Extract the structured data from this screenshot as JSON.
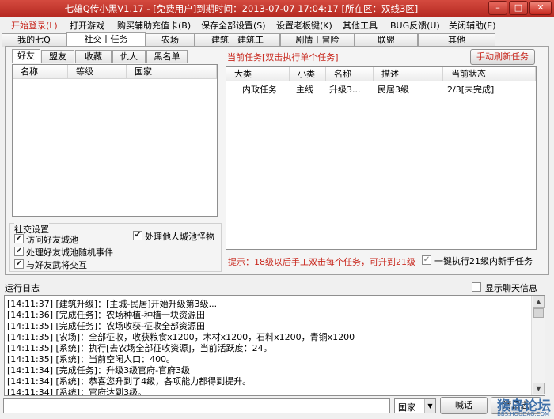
{
  "window": {
    "title": "七雄Q传小黑V1.17 - [免费用户]到期时间：2013-07-07 17:04:17 [所在区：双线3区]",
    "buttons": {
      "minimize": "–",
      "maximize": "□",
      "close": "✕"
    }
  },
  "menu": [
    "开始登录(L)",
    "打开游戏",
    "购买辅助充值卡(B)",
    "保存全部设置(S)",
    "设置老板键(K)",
    "其他工具",
    "BUG反馈(U)",
    "关闭辅助(E)"
  ],
  "tabs": [
    "我的七Q",
    "社交丨任务",
    "农场",
    "建筑丨建筑工",
    "剧情丨冒险",
    "联盟",
    "其他"
  ],
  "friends": {
    "subtabs": [
      "好友",
      "盟友",
      "收藏",
      "仇人",
      "黑名单"
    ],
    "columns": [
      "名称",
      "等级",
      "国家"
    ]
  },
  "social": {
    "title": "社交设置",
    "options": [
      {
        "label": "访问好友城池",
        "checked": true
      },
      {
        "label": "处理好友城池随机事件",
        "checked": true
      },
      {
        "label": "与好友武将交互",
        "checked": true
      },
      {
        "label": "处理他人城池怪物",
        "checked": true
      }
    ]
  },
  "tasks": {
    "title": "当前任务[双击执行单个任务]",
    "refresh_button": "手动刷新任务",
    "columns": [
      "大类",
      "小类",
      "名称",
      "描述",
      "当前状态"
    ],
    "rows": [
      {
        "category": "内政任务",
        "subcategory": "主线",
        "name": "升级3...",
        "description": "民居3级",
        "status": "2/3[未完成]"
      }
    ],
    "tip": "提示：18级以后手工双击每个任务，可升到21级",
    "auto_option": {
      "label": "一键执行21级内新手任务",
      "checked": true
    }
  },
  "log": {
    "title": "运行日志",
    "chat_option": {
      "label": "显示聊天信息",
      "checked": false
    },
    "lines": [
      "[14:11:37] [建筑升级]：[主城-民居]开始升级第3级...",
      "[14:11:36] [完成任务]：农场种植-种植一块资源田",
      "[14:11:35] [完成任务]：农场收获-征收全部资源田",
      "[14:11:35] [农场]：全部征收，收获粮食x1200，木材x1200，石料x1200，青铜x1200",
      "[14:11:35] [系统]：执行[去农场全部征收资源]，当前活跃度：24。",
      "[14:11:35] [系统]：当前空闲人口：400。",
      "[14:11:34] [完成任务]：升级3级官府-官府3级",
      "[14:11:34] [系统]：恭喜您升到了4级，各项能力都得到提升。",
      "[14:11:34] [系统]：官府达到3级。"
    ]
  },
  "chat": {
    "channel": "国家",
    "shout_button": "喊话",
    "clear_button": "清日志"
  },
  "watermark": {
    "text": "猴岛论坛",
    "url": "BBS.HOUDAO.COM"
  },
  "colors": {
    "title_bar": "#c63a30",
    "accent_red": "#c8281e"
  }
}
